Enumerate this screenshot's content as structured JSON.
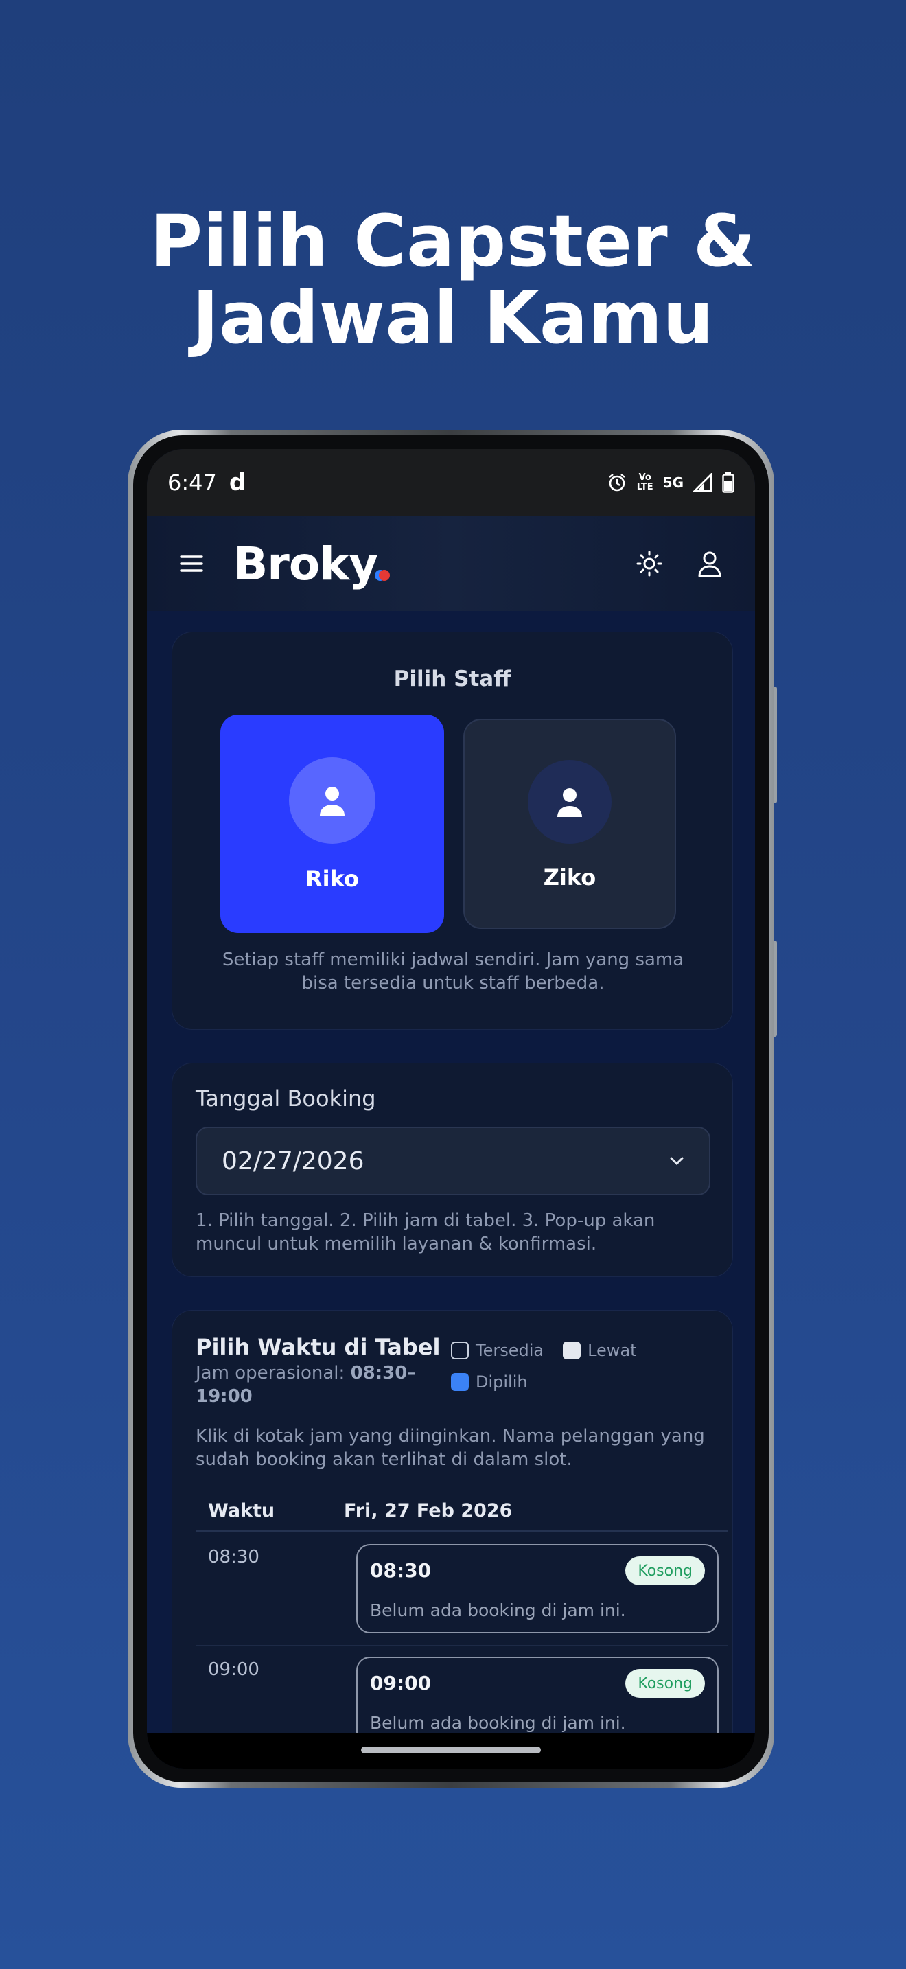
{
  "headline": {
    "line1": "Pilih Capster &",
    "line2": "Jadwal Kamu"
  },
  "status_bar": {
    "time": "6:47",
    "app_glyph": "d",
    "network": "5G",
    "volte_top": "Vo",
    "volte_bottom": "LTE"
  },
  "app": {
    "brand": "Broky",
    "icons": [
      "menu-icon",
      "sun-icon",
      "user-icon"
    ]
  },
  "staff_card": {
    "title": "Pilih Staff",
    "staff": [
      {
        "name": "Riko",
        "selected": true
      },
      {
        "name": "Ziko",
        "selected": false
      }
    ],
    "note": "Setiap staff memiliki jadwal sendiri. Jam yang sama bisa tersedia untuk staff berbeda."
  },
  "date_card": {
    "label": "Tanggal Booking",
    "value": "02/27/2026",
    "hint": "1. Pilih tanggal. 2. Pilih jam di tabel. 3. Pop-up akan muncul untuk memilih layanan & konfirmasi."
  },
  "schedule_card": {
    "title": "Pilih Waktu di Tabel",
    "hours_label": "Jam operasional:",
    "hours_value": "08:30–19:00",
    "legend": {
      "available": "Tersedia",
      "past": "Lewat",
      "chosen": "Dipilih"
    },
    "description": "Klik di kotak jam yang diinginkan. Nama pelanggan yang sudah booking akan terlihat di dalam slot.",
    "col_time": "Waktu",
    "col_date": "Fri, 27 Feb 2026",
    "rows": [
      {
        "time": "08:30",
        "slot_time": "08:30",
        "badge": "Kosong",
        "desc": "Belum ada booking di jam ini."
      },
      {
        "time": "09:00",
        "slot_time": "09:00",
        "badge": "Kosong",
        "desc": "Belum ada booking di jam ini."
      }
    ]
  },
  "colors": {
    "primary": "#2a3cff",
    "background": "#0c1a3f",
    "badge_text": "#1f9d5f",
    "badge_bg": "#e6f6ee"
  }
}
